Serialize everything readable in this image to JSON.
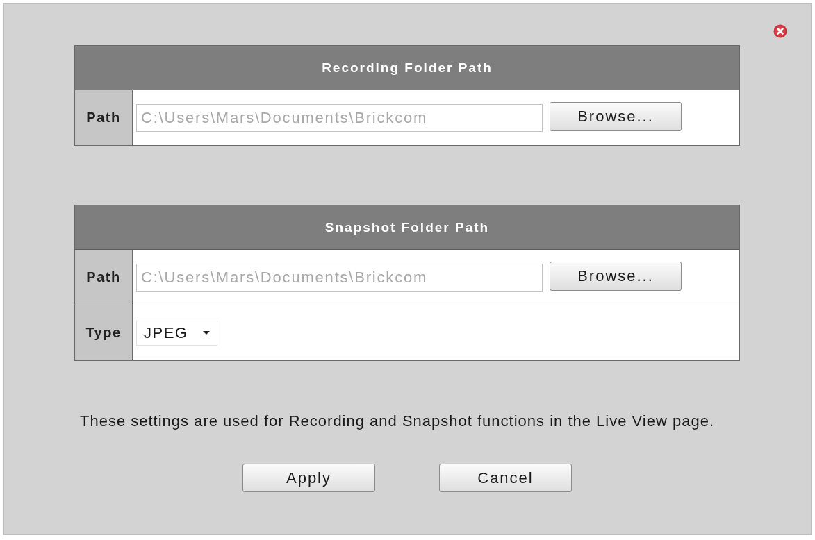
{
  "sections": [
    {
      "title": "Recording Folder Path",
      "rows": [
        {
          "kind": "path",
          "label": "Path",
          "value": "C:\\Users\\Mars\\Documents\\Brickcom",
          "disabled": true,
          "button": "Browse..."
        }
      ]
    },
    {
      "title": "Snapshot Folder Path",
      "rows": [
        {
          "kind": "path",
          "label": "Path",
          "value": "C:\\Users\\Mars\\Documents\\Brickcom",
          "disabled": true,
          "button": "Browse..."
        },
        {
          "kind": "select",
          "label": "Type",
          "value": "JPEG"
        }
      ]
    }
  ],
  "note": "These settings are used for Recording and Snapshot functions in the Live View page.",
  "buttons": [
    "Apply",
    "Cancel"
  ]
}
